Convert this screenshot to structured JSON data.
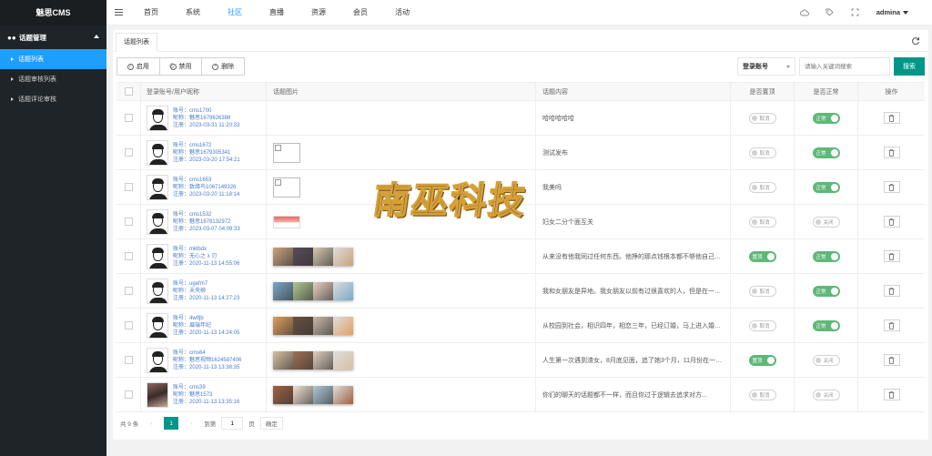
{
  "brand": "魅思CMS",
  "sidebar": {
    "group": "话题管理",
    "items": [
      {
        "label": "话题列表",
        "active": true
      },
      {
        "label": "话题审核列表",
        "active": false
      },
      {
        "label": "话题评论审核",
        "active": false
      }
    ]
  },
  "topnav": [
    "首页",
    "系统",
    "社区",
    "直播",
    "资源",
    "会员",
    "活动"
  ],
  "topnav_active": "社区",
  "user": {
    "name": "admina"
  },
  "tab": {
    "label": "话题列表"
  },
  "toolbar": {
    "enable": "启用",
    "disable": "禁用",
    "delete": "删除"
  },
  "search": {
    "select": "登录账号",
    "placeholder": "请输入关键词搜索",
    "button": "搜索"
  },
  "table": {
    "headers": [
      "登录账号/用户昵称",
      "话题图片",
      "话题内容",
      "是否置顶",
      "是否正常",
      "操作"
    ],
    "labels": {
      "account": "账号：",
      "nick": "昵称：",
      "reg": "注册："
    },
    "rows": [
      {
        "account": "cms1700",
        "nick": "魅思1679626388",
        "reg": "2023-03-31 11:20:33",
        "images": "none",
        "content": "哈哈哈哈哈",
        "top": "取消",
        "normal": "正常"
      },
      {
        "account": "cms1672",
        "nick": "魅思1679305341",
        "reg": "2023-03-20 17:54:21",
        "images": "blank",
        "content": "测试发布",
        "top": "取消",
        "normal": "正常"
      },
      {
        "account": "cms1653",
        "nick": "致缘鸟1067149326",
        "reg": "2023-03-20 11:18:14",
        "images": "blank",
        "content": "我美吗",
        "top": "取消",
        "normal": "正常"
      },
      {
        "account": "cms1532",
        "nick": "魅思1678132972",
        "reg": "2023-03-07 04:09:33",
        "images": "single",
        "content": "妇女二分个面互关",
        "top": "取消",
        "normal": "关闭"
      },
      {
        "account": "mklbdx",
        "nick": "无心之 λ 刃",
        "reg": "2020-11-13 14:55:06",
        "images": "strip",
        "content": "从来没有他我同过任何东西。他挣的那点钱根本都不够他自己花的，加上...",
        "top": "置顶",
        "normal": "正常"
      },
      {
        "account": "ugefm7",
        "nick": "未央柳",
        "reg": "2020-11-13 14:27:23",
        "images": "strip",
        "content": "我和女朋友是异地。我女朋友以前有过很喜欢的人，但是在一起之后...",
        "top": "取消",
        "normal": "正常"
      },
      {
        "account": "4wtfjb",
        "nick": "眉端年纪",
        "reg": "2020-11-13 14:24:05",
        "images": "strip",
        "content": "从校园到社会，相识四年，相恋三年，已经订婚，马上进入婚姻的殿堂...",
        "top": "取消",
        "normal": "正常"
      },
      {
        "account": "cms64",
        "nick": "魅思视频1624587406",
        "reg": "2020-11-13 13:38:35",
        "images": "strip",
        "content": "人生第一次遇到渣女，8月底见面，追了她3个月，11月份在一起...",
        "top": "置顶",
        "normal": "关闭"
      },
      {
        "account": "cms39",
        "nick": "魅思1573",
        "reg": "2020-11-13 13:35:16",
        "images": "strip",
        "content": "你们的聊天的话题都不一样，而且你过于逻辑去追求对方...",
        "top": "取消",
        "normal": "关闭"
      }
    ]
  },
  "pager": {
    "total": "共 9 条",
    "current": "1",
    "goto_label": "到第",
    "goto_value": "1",
    "page_unit": "页",
    "confirm": "确定"
  },
  "watermark": {
    "text": "南巫科技"
  },
  "colors": {
    "sidebar": "#1f2428",
    "active": "#1e9fff",
    "primary": "#009688",
    "switch_on": "#5fb878"
  }
}
